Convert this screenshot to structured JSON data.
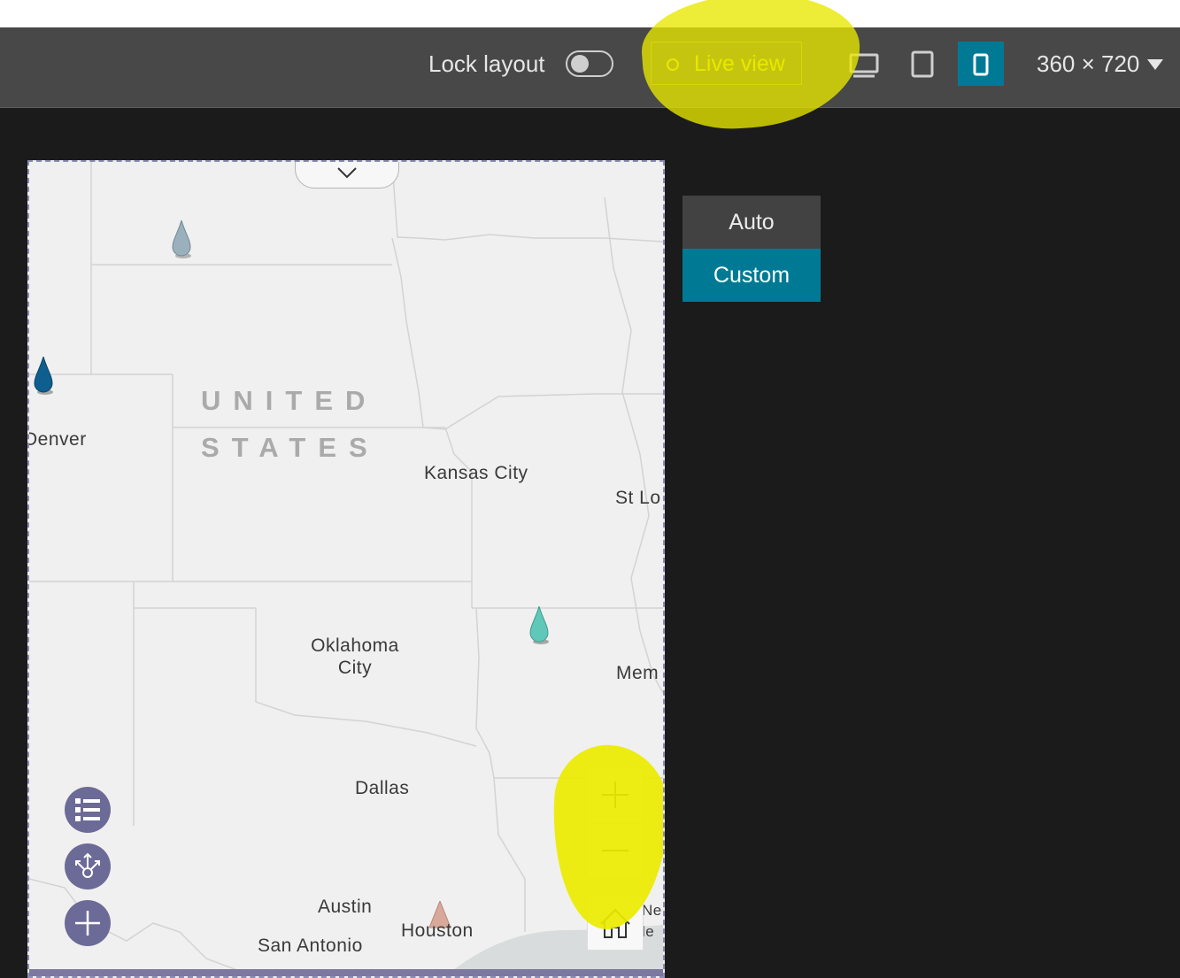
{
  "toolbar": {
    "lock_label": "Lock layout",
    "lock_toggle_on": false,
    "live_view_label": "Live view",
    "devices": [
      {
        "name": "desktop-icon",
        "active": false
      },
      {
        "name": "tablet-icon",
        "active": false
      },
      {
        "name": "phone-icon",
        "active": true
      }
    ],
    "size_label": "360 × 720",
    "size_dropdown_icon": "caret-down-icon",
    "accent_color": "#007a94"
  },
  "mode_panel": {
    "options": [
      "Auto",
      "Custom"
    ],
    "selected": "Custom"
  },
  "map": {
    "country_label_line1": "UNITED",
    "country_label_line2": "STATES",
    "cities": {
      "denver": "Denver",
      "kansas_city": "Kansas City",
      "st_louis": "St Lo",
      "oklahoma_city_line1": "Oklahoma",
      "oklahoma_city_line2": "City",
      "memphis": "Mem",
      "dallas": "Dallas",
      "austin": "Austin",
      "houston": "Houston",
      "san_antonio": "San Antonio",
      "new_orleans_1": "Ne",
      "new_orleans_2": "le"
    },
    "markers": [
      {
        "name": "marker-north",
        "color": "#9bb0bd"
      },
      {
        "name": "marker-denver",
        "color": "#0e5f8e"
      },
      {
        "name": "marker-arkansas",
        "color": "#5fc8b8"
      },
      {
        "name": "marker-houston",
        "color": "#d8a89a"
      }
    ],
    "widgets": [
      "legend-icon",
      "share-icon",
      "add-icon"
    ],
    "zoom_controls": [
      "zoom-in-icon",
      "zoom-out-icon",
      "home-icon"
    ],
    "fab_color": "#6c6a97"
  }
}
